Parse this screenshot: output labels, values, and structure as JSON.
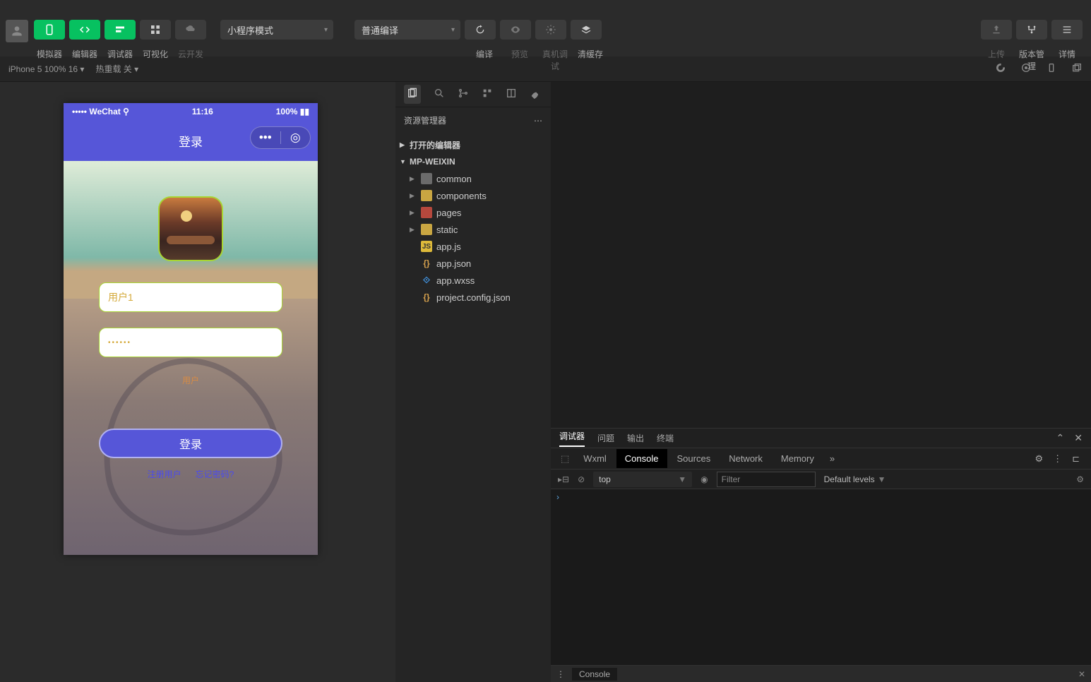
{
  "toolbar": {
    "labels": {
      "simulator": "模拟器",
      "editor": "编辑器",
      "debugger": "调试器",
      "visualize": "可视化",
      "cloud": "云开发",
      "compile": "编译",
      "preview": "预览",
      "remote": "真机调试",
      "clear_cache": "清缓存",
      "upload": "上传",
      "version": "版本管理",
      "details": "详情"
    },
    "mode_dropdown": "小程序模式",
    "compile_dropdown": "普通编译"
  },
  "secondary": {
    "device": "iPhone 5 100% 16",
    "hot_reload": "热重载 关"
  },
  "explorer": {
    "title": "资源管理器",
    "sections": {
      "open_editors": "打开的编辑器",
      "project": "MP-WEIXIN"
    },
    "folders": [
      "common",
      "components",
      "pages",
      "static"
    ],
    "files": [
      "app.js",
      "app.json",
      "app.wxss",
      "project.config.json"
    ]
  },
  "phone": {
    "carrier": "WeChat",
    "time": "11:16",
    "battery": "100%",
    "nav_title": "登录",
    "username_value": "用户1",
    "password_value": "••••••",
    "hint": "用户",
    "login_button": "登录",
    "register_link": "注册用户",
    "forgot_link": "忘记密码?"
  },
  "devtools": {
    "top_tabs": [
      "调试器",
      "问题",
      "输出",
      "终端"
    ],
    "panel_tabs": [
      "Wxml",
      "Console",
      "Sources",
      "Network",
      "Memory"
    ],
    "context": "top",
    "filter_placeholder": "Filter",
    "levels": "Default levels",
    "prompt": "›",
    "bottom_tab": "Console"
  }
}
